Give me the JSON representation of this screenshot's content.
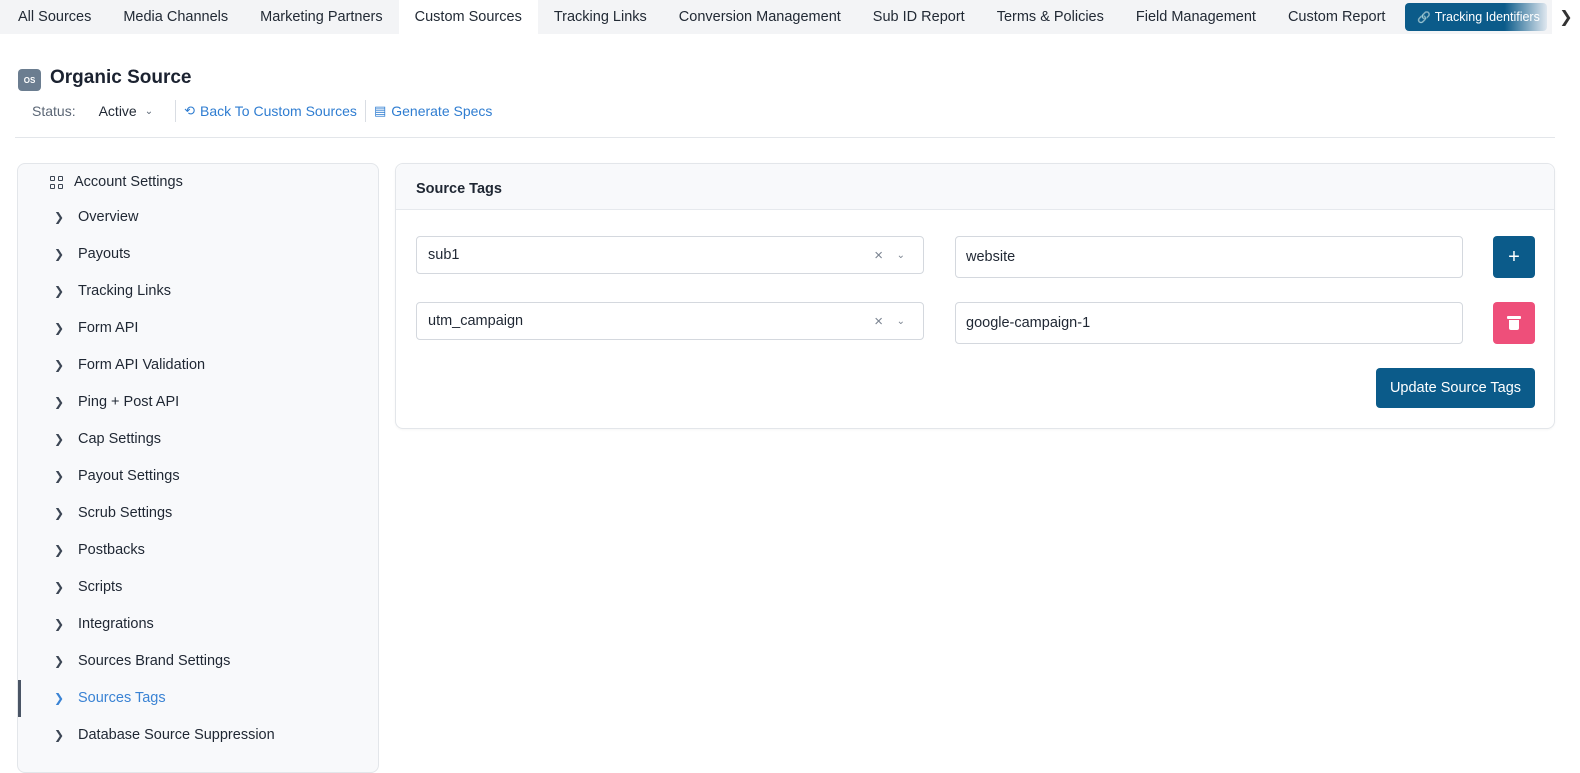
{
  "tabs": [
    {
      "label": "All Sources",
      "active": false
    },
    {
      "label": "Media Channels",
      "active": false
    },
    {
      "label": "Marketing Partners",
      "active": false
    },
    {
      "label": "Custom Sources",
      "active": true
    },
    {
      "label": "Tracking Links",
      "active": false
    },
    {
      "label": "Conversion Management",
      "active": false
    },
    {
      "label": "Sub ID Report",
      "active": false
    },
    {
      "label": "Terms & Policies",
      "active": false
    },
    {
      "label": "Field Management",
      "active": false
    },
    {
      "label": "Custom Report",
      "active": false
    }
  ],
  "tracking_button": {
    "label": "Tracking Identifiers",
    "icon": "link-icon"
  },
  "header": {
    "badge": "OS",
    "title": "Organic Source",
    "status_label": "Status:",
    "status_value": "Active",
    "back_link": "Back To Custom Sources",
    "specs_link": "Generate Specs"
  },
  "sidebar": {
    "heading": "Account Settings",
    "items": [
      {
        "label": "Overview"
      },
      {
        "label": "Payouts"
      },
      {
        "label": "Tracking Links"
      },
      {
        "label": "Form API"
      },
      {
        "label": "Form API Validation"
      },
      {
        "label": "Ping + Post API"
      },
      {
        "label": "Cap Settings"
      },
      {
        "label": "Payout Settings"
      },
      {
        "label": "Scrub Settings"
      },
      {
        "label": "Postbacks"
      },
      {
        "label": "Scripts"
      },
      {
        "label": "Integrations"
      },
      {
        "label": "Sources Brand Settings"
      },
      {
        "label": "Sources Tags"
      },
      {
        "label": "Database Source Suppression"
      }
    ],
    "active_item": "Sources Tags"
  },
  "card": {
    "title": "Source Tags",
    "rows": [
      {
        "key": "sub1",
        "value": "website",
        "action": "add"
      },
      {
        "key": "utm_campaign",
        "value": "google-campaign-1",
        "action": "delete"
      }
    ],
    "update_label": "Update Source Tags"
  },
  "colors": {
    "primary": "#0b5b8a",
    "danger": "#ee4f7a",
    "link": "#2f7dd1"
  }
}
